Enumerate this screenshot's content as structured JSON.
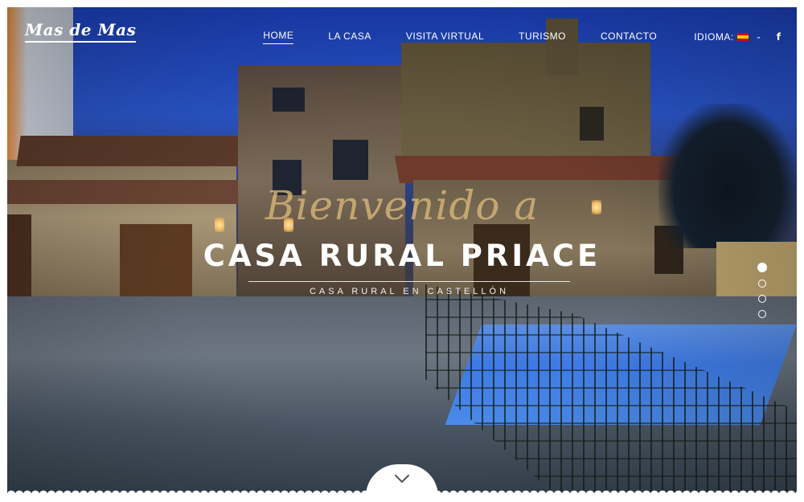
{
  "header": {
    "logo_text": "Mas de Mas",
    "nav": [
      {
        "label": "HOME",
        "active": true
      },
      {
        "label": "LA CASA",
        "active": false
      },
      {
        "label": "VISITA VIRTUAL",
        "active": false
      },
      {
        "label": "TURISMO",
        "active": false
      },
      {
        "label": "CONTACTO",
        "active": false
      }
    ],
    "language_label": "IDIOMA:",
    "language_flag": "spain-flag-icon",
    "social_icon": "facebook-icon",
    "social_glyph": "f"
  },
  "hero": {
    "script_text": "Bienvenido a",
    "title": "CASA RURAL PRIACE",
    "subtitle": "CASA RURAL EN CASTELLÓN"
  },
  "slider": {
    "dots": 4,
    "active_index": 0
  },
  "scroll_down_icon": "chevron-down-icon",
  "colors": {
    "text": "#ffffff",
    "script_gold": "#d6b478",
    "background": "#ffffff"
  }
}
